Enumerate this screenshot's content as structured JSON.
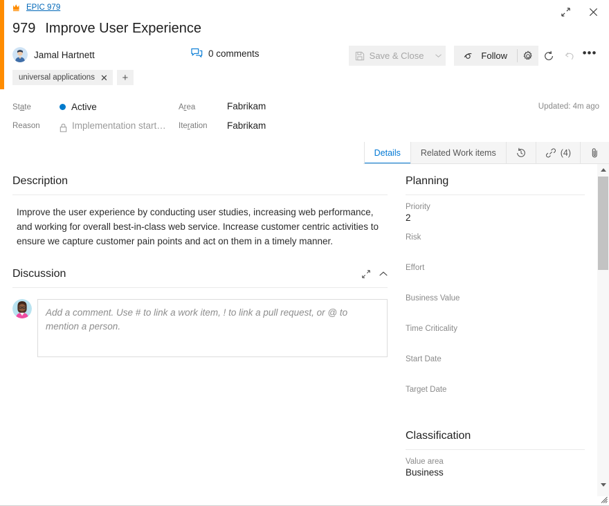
{
  "window": {
    "expand_icon": "expand-icon",
    "close_icon": "close-icon"
  },
  "header": {
    "breadcrumb_icon": "crown-icon",
    "breadcrumb_label": "EPIC 979",
    "work_item_id": "979",
    "title": "Improve User Experience",
    "assignee": "Jamal Hartnett",
    "comments_label": "0 comments",
    "comments_icon": "comment-icon"
  },
  "toolbar": {
    "save_label": "Save & Close",
    "save_icon": "save-icon",
    "caret_icon": "chevron-down-icon",
    "follow_label": "Follow",
    "follow_icon": "eye-icon",
    "gear_icon": "gear-icon",
    "refresh_icon": "refresh-icon",
    "undo_icon": "undo-icon",
    "more_icon": "ellipsis-icon",
    "more_label": "•••"
  },
  "tags": {
    "items": [
      {
        "label": "universal applications",
        "remove_icon": "close-icon"
      }
    ],
    "add_label": "+"
  },
  "fields": {
    "state_label": "State",
    "state_value": "Active",
    "state_color": "#007acc",
    "reason_label": "Reason",
    "reason_value": "Implementation start…",
    "reason_locked": true,
    "area_label": "Area",
    "area_value": "Fabrikam",
    "iteration_label": "Iteration",
    "iteration_value": "Fabrikam",
    "updated_text": "Updated: 4m ago"
  },
  "tabs": [
    {
      "label": "Details",
      "active": true,
      "icon": null,
      "count": null
    },
    {
      "label": "Related Work items",
      "active": false,
      "icon": null,
      "count": null
    },
    {
      "label": "",
      "active": false,
      "icon": "history-icon",
      "count": null
    },
    {
      "label": "",
      "active": false,
      "icon": "link-icon",
      "count": "(4)"
    },
    {
      "label": "",
      "active": false,
      "icon": "attachment-icon",
      "count": null
    }
  ],
  "main": {
    "description_title": "Description",
    "description_text": "Improve the user experience by conducting user studies, increasing web performance, and working for overall best-in-class web service. Increase customer centric activities to ensure we capture customer pain points and act on them in a timely manner.",
    "discussion_title": "Discussion",
    "discussion_expand_icon": "expand-icon",
    "discussion_collapse_icon": "chevron-up-icon",
    "comment_placeholder": "Add a comment. Use # to link a work item, ! to link a pull request, or @ to mention a person."
  },
  "side": {
    "planning_title": "Planning",
    "planning_fields": [
      {
        "label": "Priority",
        "value": "2"
      },
      {
        "label": "Risk",
        "value": ""
      },
      {
        "label": "Effort",
        "value": ""
      },
      {
        "label": "Business Value",
        "value": ""
      },
      {
        "label": "Time Criticality",
        "value": ""
      },
      {
        "label": "Start Date",
        "value": ""
      },
      {
        "label": "Target Date",
        "value": ""
      }
    ],
    "classification_title": "Classification",
    "classification_fields": [
      {
        "label": "Value area",
        "value": "Business"
      }
    ]
  },
  "scrollbar": {
    "up_icon": "chevron-up-icon",
    "down_icon": "chevron-down-icon"
  },
  "colors": {
    "accent_orange": "#ff8c00",
    "link_blue": "#0067b8",
    "tab_blue": "#0078d4",
    "state_blue": "#007acc"
  }
}
